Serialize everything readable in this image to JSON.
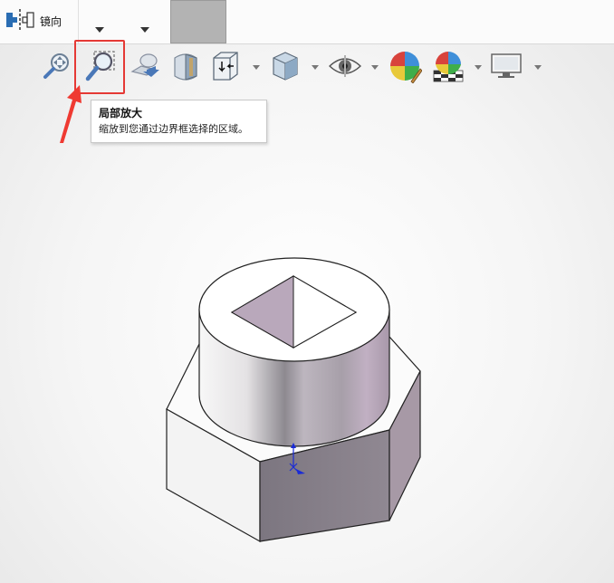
{
  "ribbon": {
    "mirror_label": "镜向",
    "icons": [
      "mirror-icon",
      "chevron-down-icon",
      "chevron-down-icon"
    ]
  },
  "hud": {
    "items": [
      {
        "name": "zoom-to-fit-icon"
      },
      {
        "name": "zoom-to-area-icon"
      },
      {
        "name": "previous-view-icon"
      },
      {
        "name": "section-view-icon"
      },
      {
        "name": "view-orientation-icon"
      },
      {
        "name": "display-style-icon"
      },
      {
        "name": "hide-show-items-icon"
      },
      {
        "name": "edit-appearance-icon"
      },
      {
        "name": "apply-scene-icon"
      },
      {
        "name": "view-settings-icon"
      }
    ]
  },
  "tooltip": {
    "title": "局部放大",
    "description": "缩放到您通过边界框选择的区域。"
  },
  "colors": {
    "highlight": "#e53935",
    "face_lilac": "#b7a8b8",
    "face_dark": "#8a8088"
  }
}
